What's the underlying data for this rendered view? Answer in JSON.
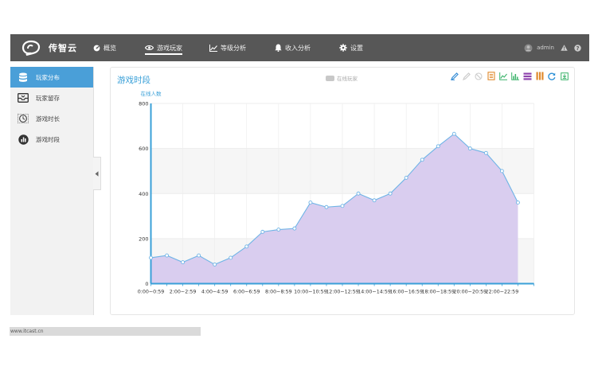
{
  "app": {
    "name": "传智云"
  },
  "nav": [
    {
      "label": "概览",
      "icon": "dashboard-icon"
    },
    {
      "label": "游戏玩家",
      "icon": "eye-icon",
      "active": true
    },
    {
      "label": "等级分析",
      "icon": "line-chart-icon"
    },
    {
      "label": "收入分析",
      "icon": "bell-icon"
    },
    {
      "label": "设置",
      "icon": "gear-icon"
    }
  ],
  "user": {
    "name": "admin"
  },
  "sidebar": {
    "items": [
      {
        "label": "玩家分布",
        "icon": "database-icon",
        "active": true
      },
      {
        "label": "玩家留存",
        "icon": "inbox-icon"
      },
      {
        "label": "游戏时长",
        "icon": "clock-icon"
      },
      {
        "label": "游戏时段",
        "icon": "bar-chart-icon"
      }
    ]
  },
  "panel": {
    "title": "游戏时段",
    "legend_label": "在线玩家"
  },
  "colors": {
    "accent": "#3aa0d8",
    "area_fill": "#d9cdef",
    "line": "#6fb4e6",
    "topbar": "#575757"
  },
  "chart_data": {
    "type": "area",
    "ylabel": "在线人数",
    "ylim": [
      0,
      800
    ],
    "yticks": [
      "0",
      "200",
      "400",
      "600",
      "800"
    ],
    "xtick_labels": [
      "0:00~0:59",
      "2:00~2:59",
      "4:00~4:59",
      "6:00~6:59",
      "8:00~8:59",
      "10:00~10:59",
      "12:00~12:59",
      "14:00~14:59",
      "16:00~16:59",
      "18:00~18:59",
      "20:00~20:59",
      "22:00~22:59"
    ],
    "series": [
      {
        "name": "在线玩家",
        "values": [
          115,
          125,
          95,
          125,
          85,
          115,
          165,
          230,
          240,
          245,
          360,
          340,
          345,
          400,
          370,
          400,
          470,
          550,
          610,
          665,
          600,
          580,
          500,
          360
        ]
      }
    ]
  },
  "footer": {
    "url": "www.itcast.cn"
  }
}
